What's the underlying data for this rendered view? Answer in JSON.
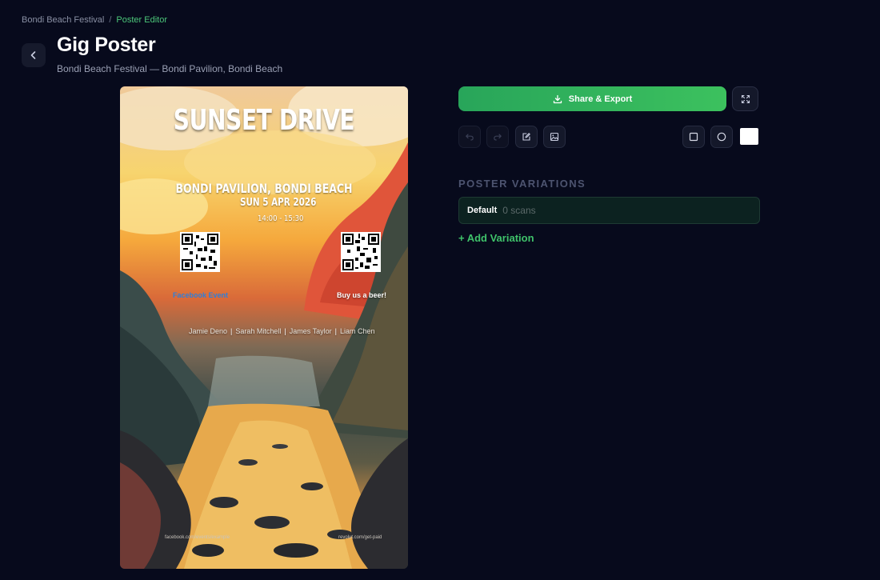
{
  "breadcrumb": {
    "parent": "Bondi Beach Festival",
    "separator": "/",
    "current": "Poster Editor"
  },
  "header": {
    "title": "Gig Poster",
    "subtitle": "Bondi Beach Festival — Bondi Pavilion, Bondi Beach",
    "back_icon": "chevron-left-icon"
  },
  "poster": {
    "title": "SUNSET DRIVE",
    "venue": "BONDI PAVILION, BONDI BEACH",
    "date": "SUN 5 APR 2026",
    "time": "14:00 - 15:30",
    "qr_left_label": "Facebook Event",
    "qr_right_label": "Buy us a beer!",
    "lineup": [
      "Jamie Deno",
      "Sarah Mitchell",
      "James Taylor",
      "Liam Chen"
    ],
    "footer_left": "facebook.com/events/example",
    "footer_right": "revolut.com/get-paid"
  },
  "toolbar": {
    "share_label": "Share & Export",
    "share_icon": "download-icon",
    "fullscreen_icon": "expand-icon",
    "undo_icon": "undo-icon",
    "redo_icon": "redo-icon",
    "edit_icon": "edit-icon",
    "image_icon": "image-icon",
    "square_icon": "square-shape-icon",
    "circle_icon": "circle-shape-icon",
    "swatch_color": "#ffffff"
  },
  "variations": {
    "section_title": "POSTER VARIATIONS",
    "items": [
      {
        "name": "Default",
        "scans": "0 scans"
      }
    ],
    "add_label": "+ Add Variation"
  },
  "colors": {
    "background": "#070a1c",
    "accent": "#3cc15e",
    "link_blue": "#2f7fd9"
  }
}
